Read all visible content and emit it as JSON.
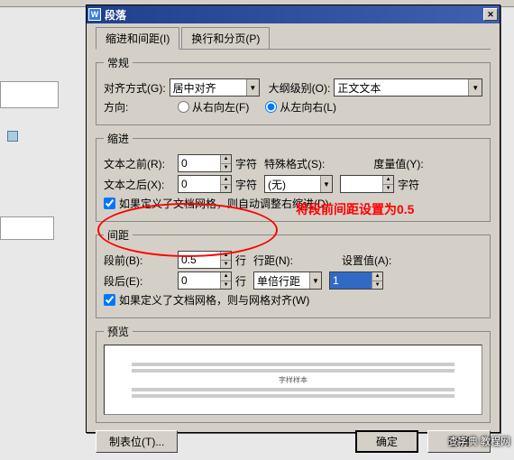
{
  "window": {
    "icon_letter": "W",
    "title": "段落",
    "close_glyph": "✕"
  },
  "tabs": {
    "tab1": "缩进和间距(I)",
    "tab2": "换行和分页(P)"
  },
  "groups": {
    "general": "常规",
    "indent": "缩进",
    "spacing": "间距",
    "preview": "预览"
  },
  "general": {
    "align_label": "对齐方式(G):",
    "align_value": "居中对齐",
    "outline_label": "大纲级别(O):",
    "outline_value": "正文文本",
    "direction_label": "方向:",
    "rtl_label": "从右向左(F)",
    "ltr_label": "从左向右(L)"
  },
  "indent": {
    "before_label": "文本之前(R):",
    "before_value": "0",
    "after_label": "文本之后(X):",
    "after_value": "0",
    "unit_char": "字符",
    "special_label": "特殊格式(S):",
    "special_value": "(无)",
    "measure_label": "度量值(Y):",
    "measure_value": "",
    "auto_label": "如果定义了文档网格，则自动调整右缩进(D)"
  },
  "spacing": {
    "before_label": "段前(B):",
    "before_value": "0.5",
    "after_label": "段后(E):",
    "after_value": "0",
    "unit_line": "行",
    "linespace_label": "行距(N):",
    "linespace_value": "单倍行距",
    "setvalue_label": "设置值(A):",
    "setvalue_value": "1",
    "grid_label": "如果定义了文档网格，则与网格对齐(W)"
  },
  "preview_sample": "字样样本",
  "buttons": {
    "tabs": "制表位(T)...",
    "ok": "确定",
    "cancel": "取消"
  },
  "annotation": "将段前间距设置为0.5",
  "watermark": "查字典   教程网",
  "glyphs": {
    "down": "▼",
    "up": "▲"
  }
}
